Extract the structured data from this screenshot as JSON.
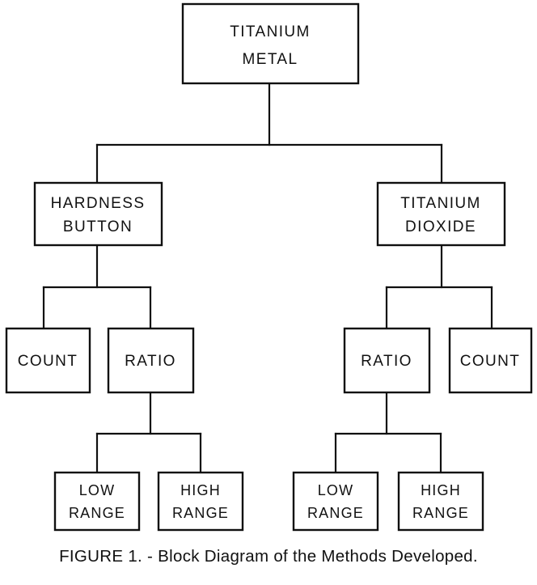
{
  "figure": {
    "caption": "FIGURE 1. - Block Diagram of the Methods Developed.",
    "line_color": "#101010",
    "background_color": "#ffffff"
  },
  "chart_data": {
    "type": "diagram",
    "title": "FIGURE 1. - Block Diagram of the Methods Developed.",
    "layout": "top-down hierarchical tree",
    "levels": 4,
    "nodes": [
      {
        "id": "titanium-metal",
        "lines": [
          "TITANIUM",
          "METAL"
        ],
        "level": 0
      },
      {
        "id": "hardness-button",
        "lines": [
          "HARDNESS",
          "BUTTON"
        ],
        "level": 1
      },
      {
        "id": "titanium-dioxide",
        "lines": [
          "TITANIUM",
          "DIOXIDE"
        ],
        "level": 1
      },
      {
        "id": "left-count",
        "lines": [
          "COUNT"
        ],
        "level": 2
      },
      {
        "id": "left-ratio",
        "lines": [
          "RATIO"
        ],
        "level": 2
      },
      {
        "id": "right-ratio",
        "lines": [
          "RATIO"
        ],
        "level": 2
      },
      {
        "id": "right-count",
        "lines": [
          "COUNT"
        ],
        "level": 2
      },
      {
        "id": "left-low-range",
        "lines": [
          "LOW",
          "RANGE"
        ],
        "level": 3
      },
      {
        "id": "left-high-range",
        "lines": [
          "HIGH",
          "RANGE"
        ],
        "level": 3
      },
      {
        "id": "right-low-range",
        "lines": [
          "LOW",
          "RANGE"
        ],
        "level": 3
      },
      {
        "id": "right-high-range",
        "lines": [
          "HIGH",
          "RANGE"
        ],
        "level": 3
      }
    ],
    "edges": [
      {
        "from": "titanium-metal",
        "to": "hardness-button"
      },
      {
        "from": "titanium-metal",
        "to": "titanium-dioxide"
      },
      {
        "from": "hardness-button",
        "to": "left-count"
      },
      {
        "from": "hardness-button",
        "to": "left-ratio"
      },
      {
        "from": "titanium-dioxide",
        "to": "right-ratio"
      },
      {
        "from": "titanium-dioxide",
        "to": "right-count"
      },
      {
        "from": "left-ratio",
        "to": "left-low-range"
      },
      {
        "from": "left-ratio",
        "to": "left-high-range"
      },
      {
        "from": "right-ratio",
        "to": "right-low-range"
      },
      {
        "from": "right-ratio",
        "to": "right-high-range"
      }
    ]
  },
  "nodes": {
    "titanium_metal": {
      "line1": "TITANIUM",
      "line2": "METAL"
    },
    "hardness_button": {
      "line1": "HARDNESS",
      "line2": "BUTTON"
    },
    "titanium_dioxide": {
      "line1": "TITANIUM",
      "line2": "DIOXIDE"
    },
    "left_count": {
      "line1": "COUNT"
    },
    "left_ratio": {
      "line1": "RATIO"
    },
    "right_ratio": {
      "line1": "RATIO"
    },
    "right_count": {
      "line1": "COUNT"
    },
    "left_low_range": {
      "line1": "LOW",
      "line2": "RANGE"
    },
    "left_high_range": {
      "line1": "HIGH",
      "line2": "RANGE"
    },
    "right_low_range": {
      "line1": "LOW",
      "line2": "RANGE"
    },
    "right_high_range": {
      "line1": "HIGH",
      "line2": "RANGE"
    }
  }
}
